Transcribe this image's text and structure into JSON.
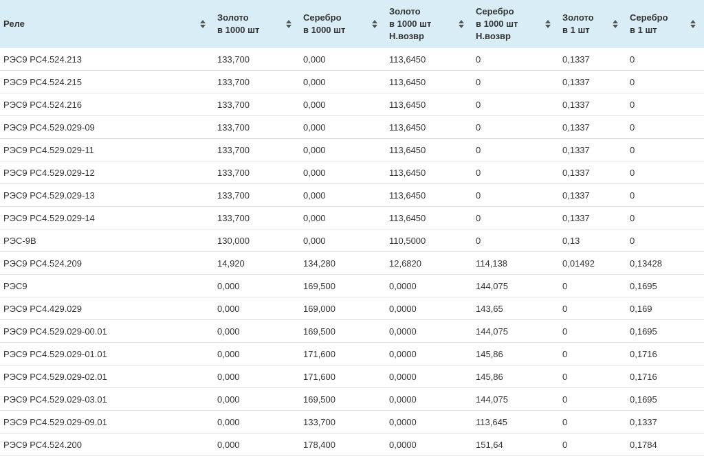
{
  "table": {
    "headers": [
      [
        "Реле"
      ],
      [
        "Золото",
        "в 1000 шт"
      ],
      [
        "Серебро",
        "в 1000 шт"
      ],
      [
        "Золото",
        "в 1000 шт",
        "Н.возвр"
      ],
      [
        "Серебро",
        "в 1000 шт",
        "Н.возвр"
      ],
      [
        "Золото",
        "в 1 шт"
      ],
      [
        "Серебро",
        "в 1 шт"
      ]
    ],
    "rows": [
      [
        "РЭС9 РС4.524.213",
        "133,700",
        "0,000",
        "113,6450",
        "0",
        "0,1337",
        "0"
      ],
      [
        "РЭС9 РС4.524.215",
        "133,700",
        "0,000",
        "113,6450",
        "0",
        "0,1337",
        "0"
      ],
      [
        "РЭС9 РС4.524.216",
        "133,700",
        "0,000",
        "113,6450",
        "0",
        "0,1337",
        "0"
      ],
      [
        "РЭС9 РС4.529.029-09",
        "133,700",
        "0,000",
        "113,6450",
        "0",
        "0,1337",
        "0"
      ],
      [
        "РЭС9 РС4.529.029-11",
        "133,700",
        "0,000",
        "113,6450",
        "0",
        "0,1337",
        "0"
      ],
      [
        "РЭС9 РС4.529.029-12",
        "133,700",
        "0,000",
        "113,6450",
        "0",
        "0,1337",
        "0"
      ],
      [
        "РЭС9 РС4.529.029-13",
        "133,700",
        "0,000",
        "113,6450",
        "0",
        "0,1337",
        "0"
      ],
      [
        "РЭС9 РС4.529.029-14",
        "133,700",
        "0,000",
        "113,6450",
        "0",
        "0,1337",
        "0"
      ],
      [
        "РЭС-9В",
        "130,000",
        "0,000",
        "110,5000",
        "0",
        "0,13",
        "0"
      ],
      [
        "РЭС9 РС4.524.209",
        "14,920",
        "134,280",
        "12,6820",
        "114,138",
        "0,01492",
        "0,13428"
      ],
      [
        "РЭС9",
        "0,000",
        "169,500",
        "0,0000",
        "144,075",
        "0",
        "0,1695"
      ],
      [
        "РЭС9 РС4.429.029",
        "0,000",
        "169,000",
        "0,0000",
        "143,65",
        "0",
        "0,169"
      ],
      [
        "РЭС9 РС4.529.029-00.01",
        "0,000",
        "169,500",
        "0,0000",
        "144,075",
        "0",
        "0,1695"
      ],
      [
        "РЭС9 РС4.529.029-01.01",
        "0,000",
        "171,600",
        "0,0000",
        "145,86",
        "0",
        "0,1716"
      ],
      [
        "РЭС9 РС4.529.029-02.01",
        "0,000",
        "171,600",
        "0,0000",
        "145,86",
        "0",
        "0,1716"
      ],
      [
        "РЭС9 РС4.529.029-03.01",
        "0,000",
        "169,500",
        "0,0000",
        "144,075",
        "0",
        "0,1695"
      ],
      [
        "РЭС9 РС4.529.029-09.01",
        "0,000",
        "133,700",
        "0,0000",
        "113,645",
        "0",
        "0,1337"
      ],
      [
        "РЭС9 РС4.524.200",
        "0,000",
        "178,400",
        "0,0000",
        "151,64",
        "0",
        "0,1784"
      ]
    ],
    "sort_icon": "sort-updown-icon"
  }
}
